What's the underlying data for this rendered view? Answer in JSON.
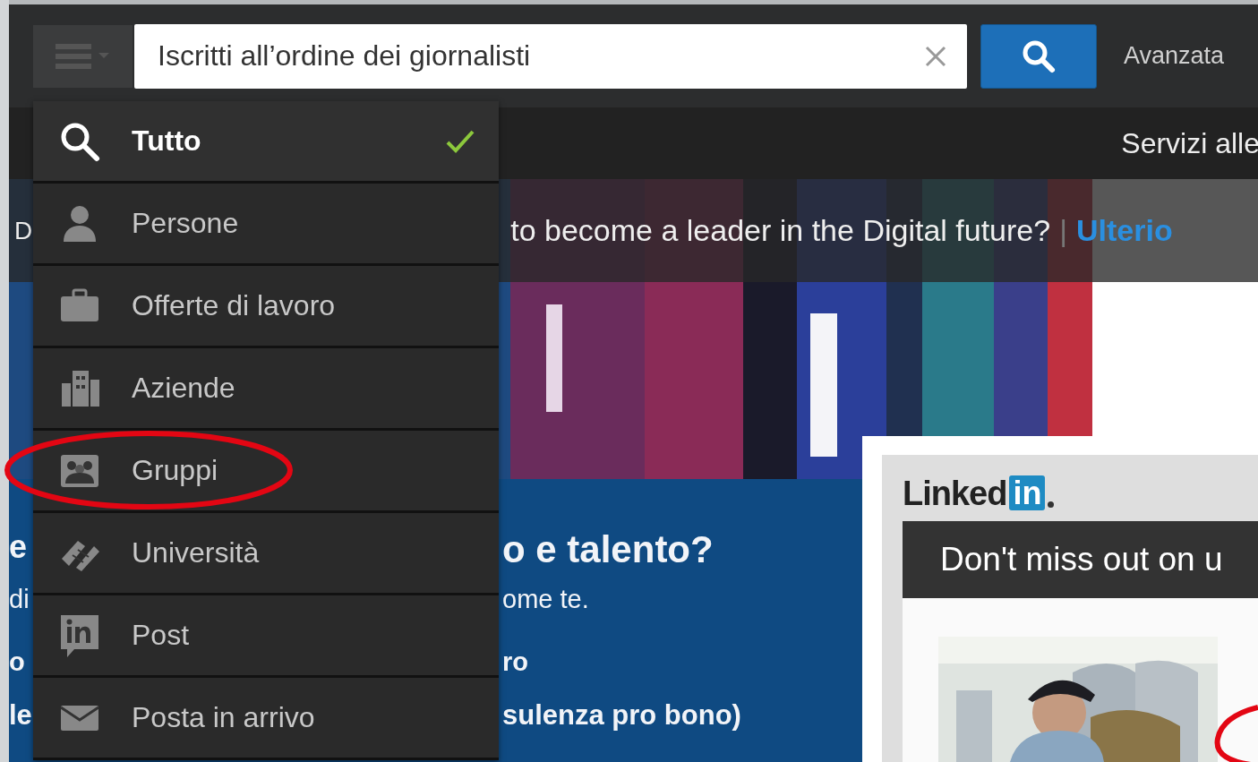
{
  "search": {
    "value": "Iscritti all’ordine dei giornalisti",
    "advanced": "Avanzata"
  },
  "nav": {
    "services": "Servizi alle"
  },
  "banner": {
    "lead": "D",
    "text": "to become a leader in the Digital future?",
    "separator": "|",
    "link": "Ulterio"
  },
  "promo": {
    "left": [
      "e",
      "di",
      "o",
      "le"
    ],
    "lines": [
      "o e talento?",
      "ome te.",
      "ro",
      "sulenza pro bono)"
    ]
  },
  "menu": [
    {
      "label": "Tutto",
      "selected": true
    },
    {
      "label": "Persone",
      "selected": false
    },
    {
      "label": "Offerte di lavoro",
      "selected": false
    },
    {
      "label": "Aziende",
      "selected": false
    },
    {
      "label": "Gruppi",
      "selected": false
    },
    {
      "label": "Università",
      "selected": false
    },
    {
      "label": "Post",
      "selected": false
    },
    {
      "label": "Posta in arrivo",
      "selected": false
    }
  ],
  "popup": {
    "logo_text": "Linked",
    "logo_badge": "in",
    "headline": "Don't miss out on u"
  }
}
